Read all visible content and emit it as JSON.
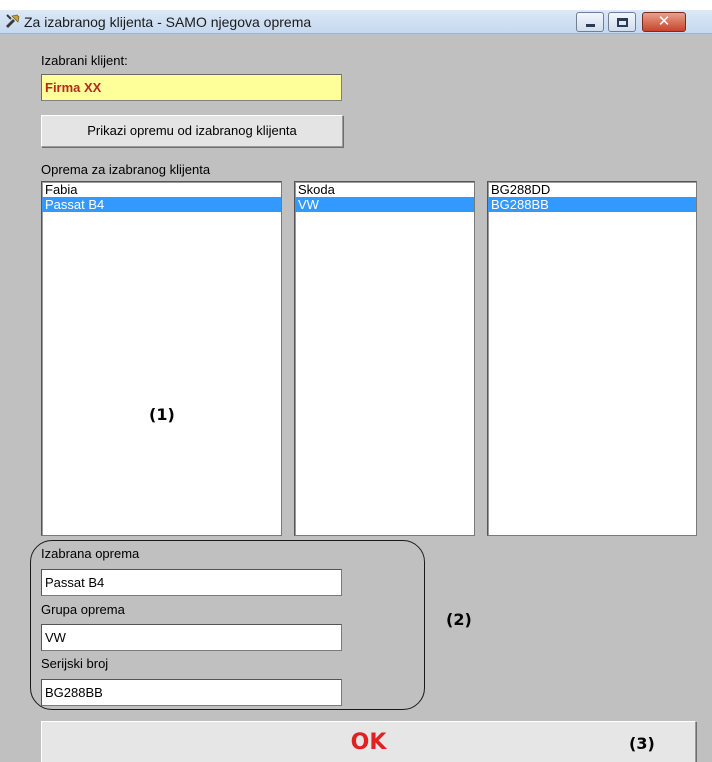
{
  "window": {
    "title": "Za izabranog klijenta - SAMO njegova oprema",
    "app_icon": "tools-icon",
    "close_glyph": "✕"
  },
  "client": {
    "label": "Izabrani klijent:",
    "value": "Firma XX",
    "field_color": "#ffff99",
    "value_color": "#b5271f"
  },
  "show_button": {
    "label": "Prikazi opremu od izabranog klijenta"
  },
  "equipment": {
    "label": "Oprema za izabranog klijenta",
    "names": [
      "Fabia",
      "Passat B4"
    ],
    "groups": [
      "Skoda",
      "VW"
    ],
    "serials": [
      "BG288DD",
      "BG288BB"
    ],
    "selected_index": 1,
    "selection_color": "#3399ff"
  },
  "details": {
    "selected_label": "Izabrana oprema",
    "selected_value": "Passat B4",
    "group_label": "Grupa oprema",
    "group_value": "VW",
    "serial_label": "Serijski broj",
    "serial_value": "BG288BB"
  },
  "ok_button": {
    "label": "OK",
    "color": "#e0211f"
  },
  "annotations": {
    "one": "(1)",
    "two": "(2)",
    "three": "(3)"
  }
}
